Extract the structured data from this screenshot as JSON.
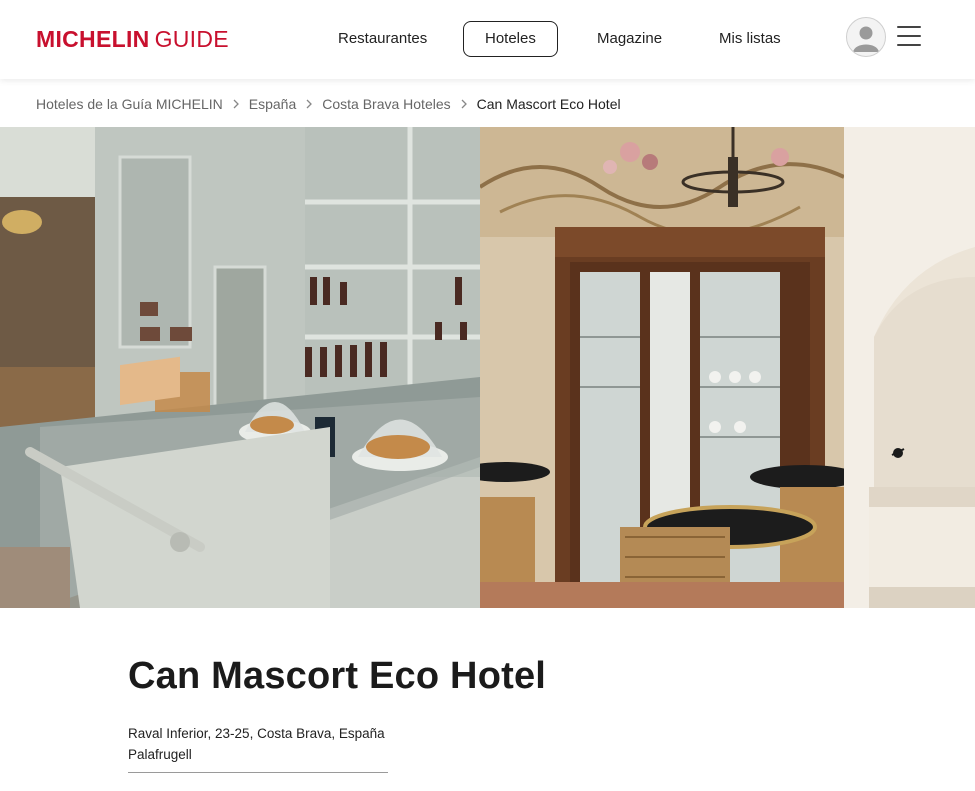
{
  "header": {
    "logo_primary": "MICHELIN",
    "logo_secondary": "GUIDE",
    "nav": [
      {
        "label": "Restaurantes",
        "active": false
      },
      {
        "label": "Hoteles",
        "active": true
      },
      {
        "label": "Magazine",
        "active": false
      },
      {
        "label": "Mis listas",
        "active": false
      }
    ],
    "avatar_icon": "user-avatar-icon",
    "menu_icon": "hamburger-menu-icon"
  },
  "breadcrumb": [
    "Hoteles de la Guía MICHELIN",
    "España",
    "Costa Brava Hoteles",
    "Can Mascort Eco Hotel"
  ],
  "hotel": {
    "name": "Can Mascort Eco Hotel",
    "address_line1": "Raval Inferior, 23-25, Costa Brava, España",
    "address_line2": "Palafrugell"
  },
  "colors": {
    "brand_red": "#c8102e",
    "text_dark": "#1b1b1b",
    "text_muted": "#666666"
  }
}
